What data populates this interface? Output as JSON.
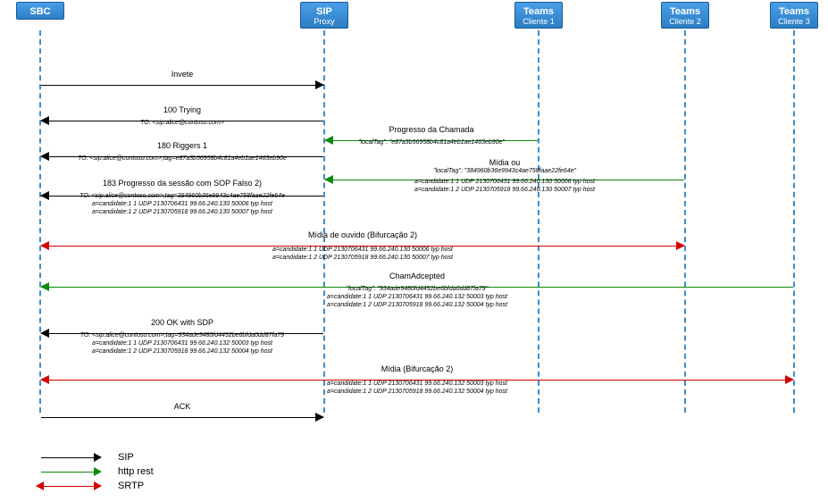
{
  "actors": {
    "sbc": {
      "label": "SBC",
      "sub": ""
    },
    "sip": {
      "label": "SIP",
      "sub": "Proxy"
    },
    "tc1": {
      "label": "Teams",
      "sub": "Cliente 1"
    },
    "tc2": {
      "label": "Teams",
      "sub": "Cliente 2"
    },
    "tc3": {
      "label": "Teams",
      "sub": "Cliente 3"
    }
  },
  "messages": {
    "m1": {
      "title": "Invete"
    },
    "m2": {
      "title": "100 Trying",
      "d1": "TO: <sip:alice@contoso.com>"
    },
    "m3": {
      "title": "Progresso da Chamada",
      "d1": "\"localTag\": \"e87a3b56958b4c81a4eb1ae1463eb90e\""
    },
    "m4": {
      "title": "180 Riggers 1",
      "d1": "TO: <sip:alice@contoso.com>;tag=e87a3b56958b4c81a4eb1ae1463eb90e"
    },
    "m5": {
      "title": "Mídia ou",
      "d1": "\"localTag\": \"384960b36e9943c4ae758faae22fe64e\"",
      "d2": "a=candidate:1 1 UDP 2130706431 99.66.240.130 50006 typ host",
      "d3": "a=candidate:1 2 UDP 2130705918 99.66.240.130 50007 typ host"
    },
    "m6": {
      "title": "183 Progresso da sessão com SOP Falso 2)",
      "d1": "TO: <sip:alice@contoso.com>;tag=384960b36e9943c4ae758faae22fe64e",
      "d2": "a=candidate:1 1 UDP 2130706431 99.66.240.130 50006 typ host",
      "d3": "a=candidate:1 2 UDP 2130705918 99.66.240.130 50007 typ host"
    },
    "m7": {
      "title": "Mídia de ouvido (Bifurcação 2)",
      "d1": "a=candidate:1 1 UDP 2130706431 99.66.240.130 50006 typ host",
      "d2": "a=candidate:1 2 UDP 2130705918 99.66.240.130 50007 typ host"
    },
    "m8": {
      "title": "ChamAdcepted",
      "d1": "\"localTag\": \"934ade9480fd4452be6bfda0dd87fa79\"",
      "d2": "a=candidate:1 1 UDP 2130706431 99.66.240.132 50003 typ host",
      "d3": "a=candidate:1 2 UDP 2130705918 99.66.240.132 50004 typ host"
    },
    "m9": {
      "title": "200 OK  with SDP",
      "d1": "TO: <sip:alice@contoso.com>;tag=934ade9480fd4452be6bfda0dd87fa79",
      "d2": "a=candidate:1 1 UDP 2130706431 99.66.240.132 50003 typ host",
      "d3": "a=candidate:1 2 UDP 2130705918 99.66.240.132 50004 typ host"
    },
    "m10": {
      "title": "Mídia (Bifurcação 2)",
      "d1": "a=candidate:1 1 UDP 2130706431 99.66.240.132 50003 typ host",
      "d2": "a=candidate:1 2 UDP 2130705918 99.66.240.132 50004 typ host"
    },
    "m11": {
      "title": "ACK"
    }
  },
  "legend": {
    "sip": "SIP",
    "http": "http rest",
    "srtp": "SRTP"
  }
}
